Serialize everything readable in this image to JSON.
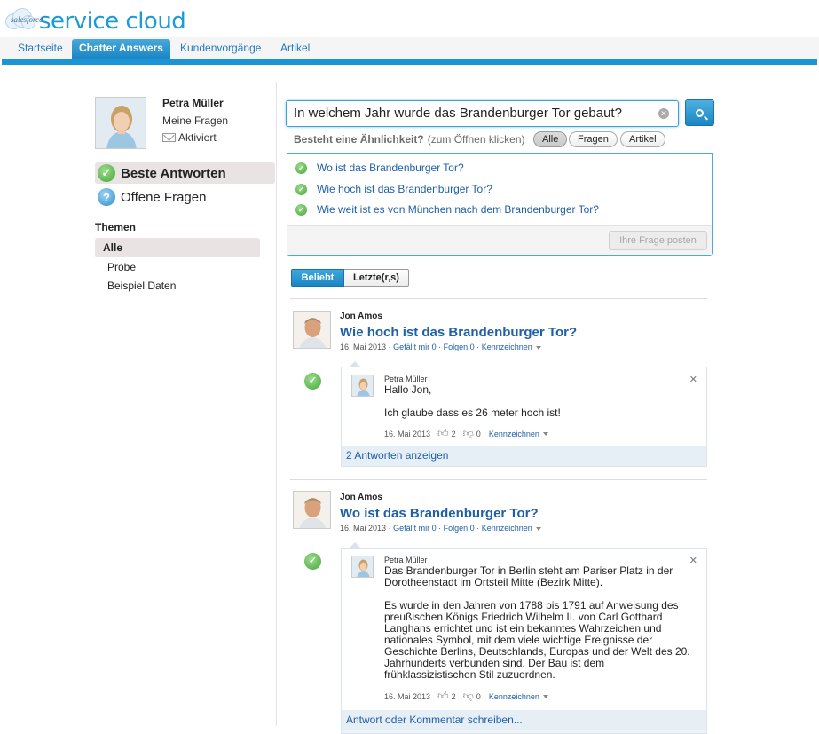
{
  "header": {
    "logo_small": "salesforce",
    "logo_main": "service cloud",
    "brand_color": "#1a9bd7"
  },
  "nav": {
    "tabs": [
      "Startseite",
      "Chatter Answers",
      "Kundenvorgänge",
      "Artikel"
    ],
    "active": "Chatter Answers"
  },
  "sidebar": {
    "profile": {
      "name": "Petra Müller",
      "my_questions": "Meine Fragen",
      "status": "Aktiviert"
    },
    "views": [
      {
        "label": "Beste Antworten",
        "icon": "green-check-icon",
        "selected": true
      },
      {
        "label": "Offene Fragen",
        "icon": "question-icon",
        "selected": false
      }
    ],
    "themes_title": "Themen",
    "themes": [
      "Alle",
      "Probe",
      "Beispiel Daten"
    ]
  },
  "search": {
    "value": "In welchem Jahr wurde das Brandenburger Tor gebaut?",
    "similar_label": "Besteht eine Ähnlichkeit?",
    "similar_hint": "(zum Öffnen klicken)",
    "filters": [
      "Alle",
      "Fragen",
      "Artikel"
    ],
    "suggestions": [
      "Wo ist das Brandenburger Tor?",
      "Wie hoch ist das Brandenburger Tor?",
      "Wie weit ist es von München nach dem Brandenburger Tor?"
    ],
    "post_button": "Ihre Frage posten"
  },
  "sort": {
    "options": [
      "Beliebt",
      "Letzte(r,s)"
    ]
  },
  "posts": [
    {
      "author": "Jon Amos",
      "title": "Wie hoch ist das Brandenburger Tor?",
      "date": "16. Mai 2013",
      "likes": "Gefällt mir 0",
      "follows": "Folgen 0",
      "flag": "Kennzeichnen",
      "answer": {
        "author": "Petra Müller",
        "text_lines": [
          "Hallo Jon,",
          "",
          "Ich glaube dass es 26 meter hoch ist!"
        ],
        "date": "16. Mai 2013",
        "up": "2",
        "down": "0",
        "flag": "Kennzeichnen"
      },
      "footer": "2 Antworten anzeigen"
    },
    {
      "author": "Jon Amos",
      "title": "Wo ist das Brandenburger Tor?",
      "date": "16. Mai 2013",
      "likes": "Gefällt mir 0",
      "follows": "Folgen 0",
      "flag": "Kennzeichnen",
      "answer": {
        "author": "Petra Müller",
        "text_lines": [
          "Das Brandenburger Tor in Berlin steht am Pariser Platz in der",
          "Dorotheenstadt im Ortsteil Mitte (Bezirk Mitte).",
          "",
          "Es wurde in den Jahren von 1788 bis 1791 auf Anweisung des",
          "preußischen Königs Friedrich Wilhelm II. von Carl Gotthard",
          "Langhans errichtet und ist ein bekanntes Wahrzeichen und",
          "nationales Symbol, mit dem viele wichtige Ereignisse der",
          "Geschichte Berlins, Deutschlands, Europas und der Welt des 20.",
          "Jahrhunderts verbunden sind. Der Bau ist dem",
          "frühklassizistischen Stil zuzuordnen."
        ],
        "date": "16. Mai 2013",
        "up": "2",
        "down": "0",
        "flag": "Kennzeichnen"
      },
      "footer": "Antwort oder Kommentar schreiben..."
    }
  ]
}
